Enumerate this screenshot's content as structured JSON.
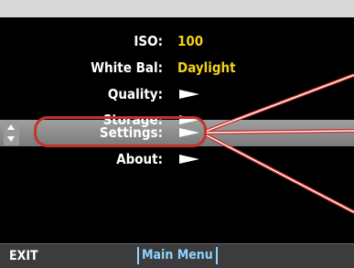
{
  "menu": {
    "items": [
      {
        "label": "ISO:",
        "value": "100"
      },
      {
        "label": "White Bal:",
        "value": "Daylight"
      },
      {
        "label": "Quality:",
        "icon": "right-arrow-icon"
      },
      {
        "label": "Storage:",
        "icon": "right-arrow-icon"
      },
      {
        "label": "Settings:",
        "icon": "right-arrow-icon",
        "selected": true
      },
      {
        "label": "About:",
        "icon": "right-arrow-icon"
      }
    ]
  },
  "footer": {
    "left_label": "EXIT",
    "center_label": "Main Menu"
  },
  "colors": {
    "value_text": "#f3d21a",
    "highlight_border": "#c6312a",
    "callout_line": "#c6312a",
    "footer_tab": "#8fd4ff",
    "selection_bar": "#8a8a8a"
  }
}
